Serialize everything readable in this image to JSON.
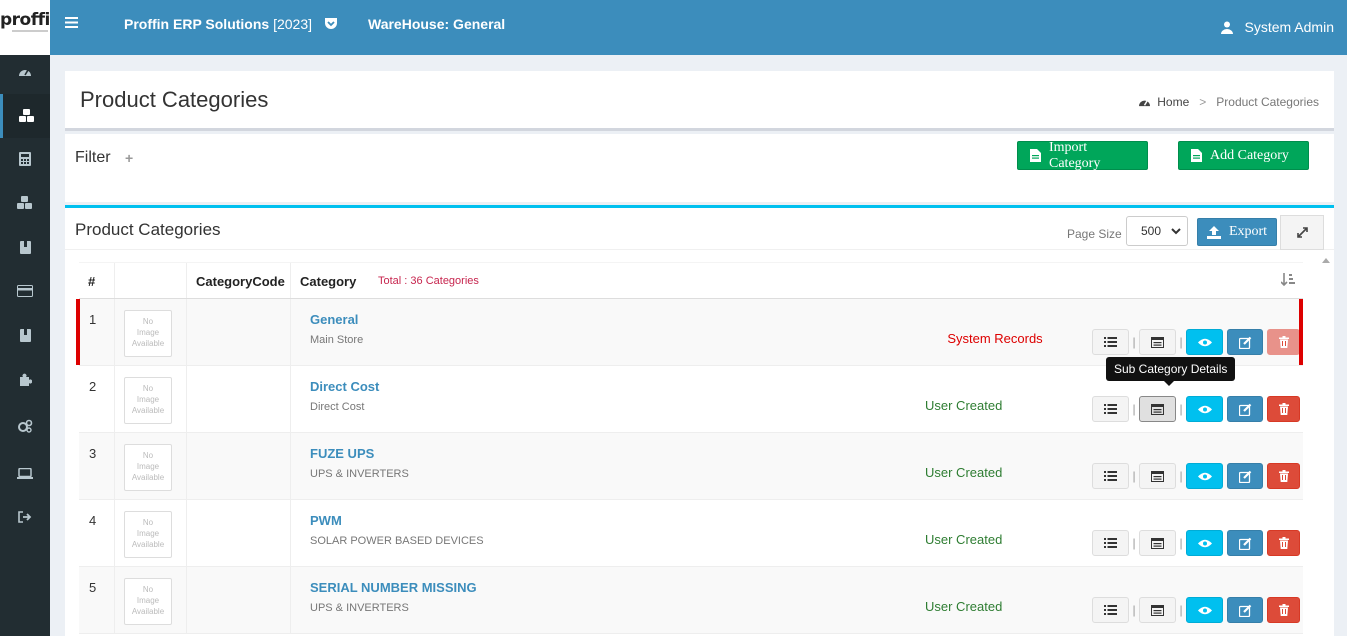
{
  "logo": {
    "text": "proffin"
  },
  "topbar": {
    "brand": "Proffin ERP Solutions",
    "year": "[2023]",
    "warehouse": "WareHouse: General",
    "user": "System Admin"
  },
  "sidebar": {
    "items": [
      {
        "icon": "dashboard-icon"
      },
      {
        "icon": "cubes-icon",
        "active": true
      },
      {
        "icon": "calculator-icon"
      },
      {
        "icon": "cubes-icon"
      },
      {
        "icon": "book-icon"
      },
      {
        "icon": "credit-card-icon"
      },
      {
        "icon": "book-icon"
      },
      {
        "icon": "puzzle-icon"
      },
      {
        "icon": "cogs-icon"
      },
      {
        "icon": "laptop-icon"
      },
      {
        "icon": "sign-out-icon"
      }
    ]
  },
  "page": {
    "title": "Product Categories",
    "breadcrumb_home": "Home",
    "breadcrumb_current": "Product Categories"
  },
  "filter": {
    "title": "Filter",
    "plus": "+",
    "import_label": "Import Category",
    "add_label": "Add Category"
  },
  "table": {
    "title": "Product Categories",
    "page_size_label": "Page Size",
    "page_size_value": "500",
    "export_label": "Export",
    "columns": {
      "num": "#",
      "code": "CategoryCode",
      "category": "Category"
    },
    "total": "Total : 36 Categories",
    "no_image": "No Image Available",
    "tooltip": "Sub Category Details",
    "rows": [
      {
        "num": "1",
        "name": "General",
        "desc": "Main Store",
        "status": "System Records",
        "system": true
      },
      {
        "num": "2",
        "name": "Direct Cost",
        "desc": "Direct Cost",
        "status": "User Created",
        "system": false
      },
      {
        "num": "3",
        "name": "FUZE UPS",
        "desc": "UPS & INVERTERS",
        "status": "User Created",
        "system": false
      },
      {
        "num": "4",
        "name": "PWM",
        "desc": "SOLAR POWER BASED DEVICES",
        "status": "User Created",
        "system": false
      },
      {
        "num": "5",
        "name": "SERIAL NUMBER MISSING",
        "desc": "UPS & INVERTERS",
        "status": "User Created",
        "system": false
      }
    ]
  },
  "colors": {
    "header_blue": "#3c8dbc",
    "sidebar": "#222d32",
    "green": "#00a65a",
    "cyan": "#00c0ef",
    "red": "#dd4b39"
  }
}
